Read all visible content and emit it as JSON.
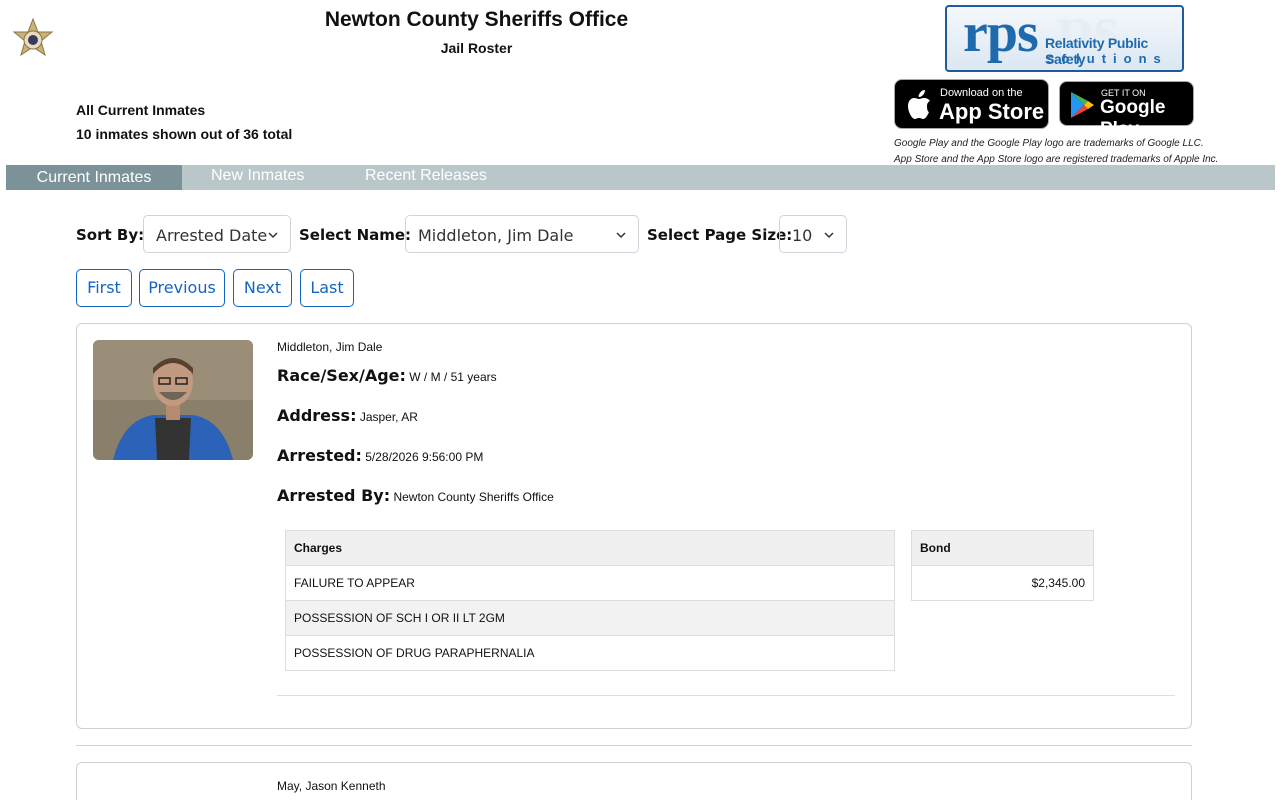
{
  "header": {
    "title": "Newton County Sheriffs Office",
    "subtitle": "Jail Roster"
  },
  "branding": {
    "rps_big": "rps",
    "rps_line1": "Relativity Public Safety",
    "rps_line2": "solutions",
    "appstore_small": "Download on the",
    "appstore_large": "App Store",
    "googleplay_small": "GET IT ON",
    "googleplay_large": "Google Play",
    "trademark_google": "Google Play and the Google Play logo are trademarks of Google LLC.",
    "trademark_apple": "App Store and the App Store logo are registered trademarks of Apple Inc."
  },
  "summary": {
    "heading": "All Current Inmates",
    "count": "10 inmates shown out of 36 total"
  },
  "tabs": [
    {
      "label": "Current Inmates",
      "active": true
    },
    {
      "label": "New Inmates",
      "active": false
    },
    {
      "label": "Recent Releases",
      "active": false
    }
  ],
  "controls": {
    "sort_label": "Sort By:",
    "sort_value": "Arrested Date",
    "name_label": "Select Name:",
    "name_value": "Middleton, Jim Dale",
    "page_size_label": "Select Page Size:",
    "page_size_value": "10"
  },
  "pagination": {
    "first": "First",
    "previous": "Previous",
    "next": "Next",
    "last": "Last"
  },
  "inmates": [
    {
      "name": "Middleton, Jim Dale",
      "race_sex_age_label": "Race/Sex/Age:",
      "race_sex_age": "W / M / 51 years",
      "address_label": "Address:",
      "address": "Jasper, AR",
      "arrested_label": "Arrested:",
      "arrested": "5/28/2026 9:56:00 PM",
      "arrested_by_label": "Arrested By:",
      "arrested_by": "Newton County Sheriffs Office",
      "charges_header": "Charges",
      "charges": [
        "FAILURE TO APPEAR",
        "POSSESSION OF SCH I OR II LT 2GM",
        "POSSESSION OF DRUG PARAPHERNALIA"
      ],
      "bond_header": "Bond",
      "bonds": [
        "$2,345.00"
      ]
    },
    {
      "name": "May, Jason Kenneth"
    }
  ],
  "colors": {
    "nav_bg": "#bac7ca",
    "nav_active": "#7b9398",
    "button_blue": "#1565c0",
    "rps_blue": "#1e6aad"
  }
}
